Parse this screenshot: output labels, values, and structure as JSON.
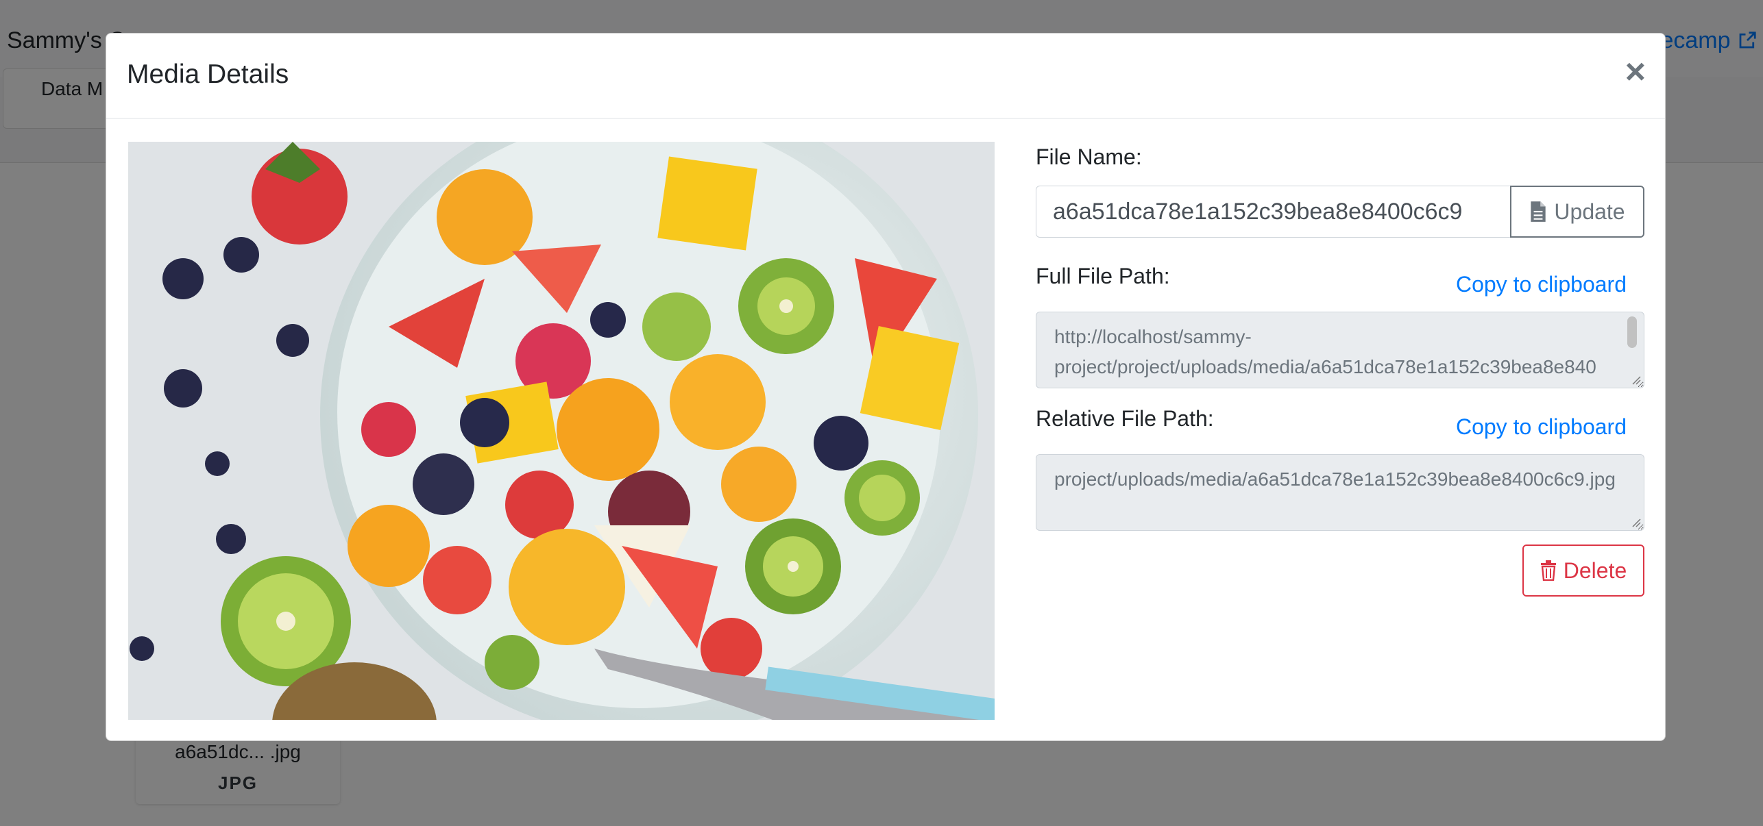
{
  "background": {
    "brand": "Sammy's C",
    "nav_right": "secamp",
    "tab_label": "Data M",
    "card": {
      "file_name": "a6a51dc... .jpg",
      "file_type": "JPG"
    }
  },
  "modal": {
    "title": "Media Details",
    "close_symbol": "×",
    "image_alt": "Fruit salad in a bowl",
    "file_name": {
      "label": "File Name:",
      "value": "a6a51dca78e1a152c39bea8e8400c6c9",
      "update_label": "Update",
      "update_icon": "file-icon"
    },
    "full_path": {
      "label": "Full File Path:",
      "copy_label": "Copy to clipboard",
      "line1": "http://localhost/sammy-",
      "line2": "project/project/uploads/media/a6a51dca78e1a152c39bea8e840"
    },
    "relative_path": {
      "label": "Relative File Path:",
      "copy_label": "Copy to clipboard",
      "value": "project/uploads/media/a6a51dca78e1a152c39bea8e8400c6c9.jpg"
    },
    "delete_label": "Delete",
    "delete_icon": "trash-icon"
  },
  "colors": {
    "primary": "#007bff",
    "danger": "#dc3545",
    "secondary": "#6c757d"
  }
}
